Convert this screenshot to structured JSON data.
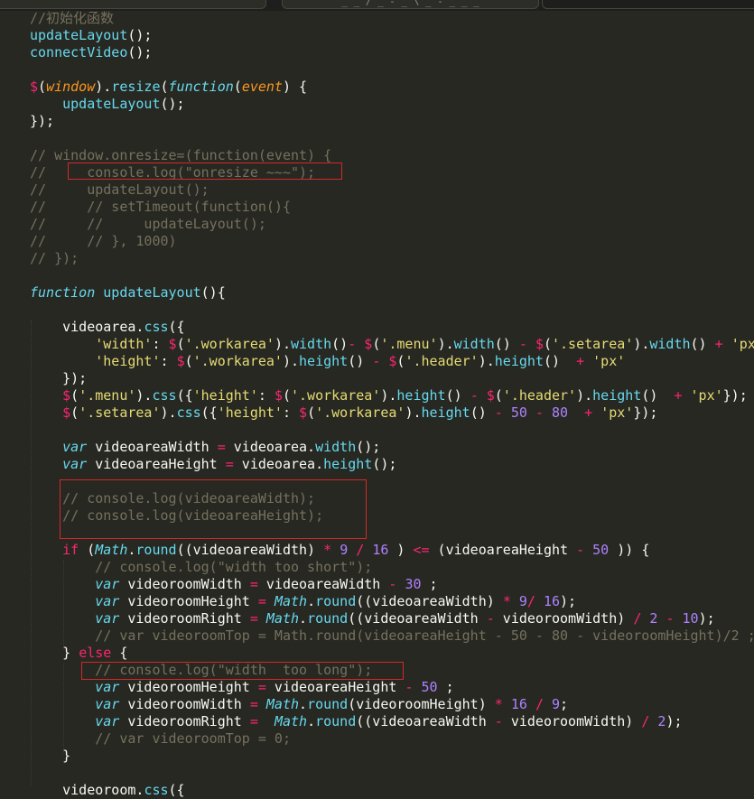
{
  "editor": {
    "tabs": [
      "",
      "_        _ / _ - _ \\ _ - _ _ _",
      ""
    ],
    "lines": [
      [
        [
          "c",
          "//初始化函数"
        ]
      ],
      [
        [
          "f",
          "updateLayout"
        ],
        [
          "m",
          "();"
        ]
      ],
      [
        [
          "f",
          "connectVideo"
        ],
        [
          "m",
          "();"
        ]
      ],
      [],
      [
        [
          "o",
          "$"
        ],
        [
          "m",
          "("
        ],
        [
          "p",
          "window"
        ],
        [
          "m",
          ")."
        ],
        [
          "f",
          "resize"
        ],
        [
          "m",
          "("
        ],
        [
          "k",
          "function"
        ],
        [
          "m",
          "("
        ],
        [
          "p",
          "event"
        ],
        [
          "m",
          ") {"
        ]
      ],
      [
        [
          "m",
          "    "
        ],
        [
          "f",
          "updateLayout"
        ],
        [
          "m",
          "();"
        ]
      ],
      [
        [
          "m",
          "});"
        ]
      ],
      [],
      [
        [
          "c",
          "// window.onresize=(function(event) {"
        ]
      ],
      [
        [
          "c",
          "//     console.log(\"onresize ~~~\");"
        ]
      ],
      [
        [
          "c",
          "//     updateLayout();"
        ]
      ],
      [
        [
          "c",
          "//     // setTimeout(function(){"
        ]
      ],
      [
        [
          "c",
          "//     //     updateLayout();"
        ]
      ],
      [
        [
          "c",
          "//     // }, 1000)"
        ]
      ],
      [
        [
          "c",
          "// });"
        ]
      ],
      [],
      [
        [
          "k",
          "function"
        ],
        [
          "m",
          " "
        ],
        [
          "f",
          "updateLayout"
        ],
        [
          "m",
          "(){"
        ]
      ],
      [],
      [
        [
          "m",
          "    videoarea."
        ],
        [
          "f",
          "css"
        ],
        [
          "m",
          "({"
        ]
      ],
      [
        [
          "m",
          "        "
        ],
        [
          "s",
          "'width'"
        ],
        [
          "m",
          ": "
        ],
        [
          "o",
          "$"
        ],
        [
          "m",
          "("
        ],
        [
          "s",
          "'.workarea'"
        ],
        [
          "m",
          ")."
        ],
        [
          "f",
          "width"
        ],
        [
          "m",
          "()"
        ],
        [
          "o",
          "-"
        ],
        [
          "m",
          " "
        ],
        [
          "o",
          "$"
        ],
        [
          "m",
          "("
        ],
        [
          "s",
          "'.menu'"
        ],
        [
          "m",
          ")."
        ],
        [
          "f",
          "width"
        ],
        [
          "m",
          "() "
        ],
        [
          "o",
          "-"
        ],
        [
          "m",
          " "
        ],
        [
          "o",
          "$"
        ],
        [
          "m",
          "("
        ],
        [
          "s",
          "'.setarea'"
        ],
        [
          "m",
          ")."
        ],
        [
          "f",
          "width"
        ],
        [
          "m",
          "() "
        ],
        [
          "o",
          "+"
        ],
        [
          "m",
          " "
        ],
        [
          "s",
          "'px'"
        ]
      ],
      [
        [
          "m",
          "        "
        ],
        [
          "s",
          "'height'"
        ],
        [
          "m",
          ": "
        ],
        [
          "o",
          "$"
        ],
        [
          "m",
          "("
        ],
        [
          "s",
          "'.workarea'"
        ],
        [
          "m",
          ")."
        ],
        [
          "f",
          "height"
        ],
        [
          "m",
          "() "
        ],
        [
          "o",
          "-"
        ],
        [
          "m",
          " "
        ],
        [
          "o",
          "$"
        ],
        [
          "m",
          "("
        ],
        [
          "s",
          "'.header'"
        ],
        [
          "m",
          ")."
        ],
        [
          "f",
          "height"
        ],
        [
          "m",
          "()  "
        ],
        [
          "o",
          "+"
        ],
        [
          "m",
          " "
        ],
        [
          "s",
          "'px'"
        ]
      ],
      [
        [
          "m",
          "    });"
        ]
      ],
      [
        [
          "m",
          "    "
        ],
        [
          "o",
          "$"
        ],
        [
          "m",
          "("
        ],
        [
          "s",
          "'.menu'"
        ],
        [
          "m",
          ")."
        ],
        [
          "f",
          "css"
        ],
        [
          "m",
          "({"
        ],
        [
          "s",
          "'height'"
        ],
        [
          "m",
          ": "
        ],
        [
          "o",
          "$"
        ],
        [
          "m",
          "("
        ],
        [
          "s",
          "'.workarea'"
        ],
        [
          "m",
          ")."
        ],
        [
          "f",
          "height"
        ],
        [
          "m",
          "() "
        ],
        [
          "o",
          "-"
        ],
        [
          "m",
          " "
        ],
        [
          "o",
          "$"
        ],
        [
          "m",
          "("
        ],
        [
          "s",
          "'.header'"
        ],
        [
          "m",
          ")."
        ],
        [
          "f",
          "height"
        ],
        [
          "m",
          "()  "
        ],
        [
          "o",
          "+"
        ],
        [
          "m",
          " "
        ],
        [
          "s",
          "'px'"
        ],
        [
          "m",
          "});"
        ]
      ],
      [
        [
          "m",
          "    "
        ],
        [
          "o",
          "$"
        ],
        [
          "m",
          "("
        ],
        [
          "s",
          "'.setarea'"
        ],
        [
          "m",
          ")."
        ],
        [
          "f",
          "css"
        ],
        [
          "m",
          "({"
        ],
        [
          "s",
          "'height'"
        ],
        [
          "m",
          ": "
        ],
        [
          "o",
          "$"
        ],
        [
          "m",
          "("
        ],
        [
          "s",
          "'.workarea'"
        ],
        [
          "m",
          ")."
        ],
        [
          "f",
          "height"
        ],
        [
          "m",
          "() "
        ],
        [
          "o",
          "-"
        ],
        [
          "m",
          " "
        ],
        [
          "n",
          "50"
        ],
        [
          "m",
          " "
        ],
        [
          "o",
          "-"
        ],
        [
          "m",
          " "
        ],
        [
          "n",
          "80"
        ],
        [
          "m",
          "  "
        ],
        [
          "o",
          "+"
        ],
        [
          "m",
          " "
        ],
        [
          "s",
          "'px'"
        ],
        [
          "m",
          "});"
        ]
      ],
      [],
      [
        [
          "m",
          "    "
        ],
        [
          "k",
          "var"
        ],
        [
          "m",
          " videoareaWidth "
        ],
        [
          "o",
          "="
        ],
        [
          "m",
          " videoarea."
        ],
        [
          "f",
          "width"
        ],
        [
          "m",
          "();"
        ]
      ],
      [
        [
          "m",
          "    "
        ],
        [
          "k",
          "var"
        ],
        [
          "m",
          " videoareaHeight "
        ],
        [
          "o",
          "="
        ],
        [
          "m",
          " videoarea."
        ],
        [
          "f",
          "height"
        ],
        [
          "m",
          "();"
        ]
      ],
      [],
      [
        [
          "m",
          "    "
        ],
        [
          "c",
          "// console.log(videoareaWidth);"
        ]
      ],
      [
        [
          "m",
          "    "
        ],
        [
          "c",
          "// console.log(videoareaHeight);"
        ]
      ],
      [],
      [
        [
          "m",
          "    "
        ],
        [
          "o",
          "if"
        ],
        [
          "m",
          " ("
        ],
        [
          "sd",
          "Math"
        ],
        [
          "m",
          "."
        ],
        [
          "f",
          "round"
        ],
        [
          "m",
          "((videoareaWidth) "
        ],
        [
          "o",
          "*"
        ],
        [
          "m",
          " "
        ],
        [
          "n",
          "9"
        ],
        [
          "m",
          " "
        ],
        [
          "o",
          "/"
        ],
        [
          "m",
          " "
        ],
        [
          "n",
          "16"
        ],
        [
          "m",
          " ) "
        ],
        [
          "o",
          "<="
        ],
        [
          "m",
          " (videoareaHeight "
        ],
        [
          "o",
          "-"
        ],
        [
          "m",
          " "
        ],
        [
          "n",
          "50"
        ],
        [
          "m",
          " )) {"
        ]
      ],
      [
        [
          "m",
          "        "
        ],
        [
          "c",
          "// console.log(\"width too short\");"
        ]
      ],
      [
        [
          "m",
          "        "
        ],
        [
          "k",
          "var"
        ],
        [
          "m",
          " videoroomWidth "
        ],
        [
          "o",
          "="
        ],
        [
          "m",
          " videoareaWidth "
        ],
        [
          "o",
          "-"
        ],
        [
          "m",
          " "
        ],
        [
          "n",
          "30"
        ],
        [
          "m",
          " ;"
        ]
      ],
      [
        [
          "m",
          "        "
        ],
        [
          "k",
          "var"
        ],
        [
          "m",
          " videoroomHeight "
        ],
        [
          "o",
          "="
        ],
        [
          "m",
          " "
        ],
        [
          "sd",
          "Math"
        ],
        [
          "m",
          "."
        ],
        [
          "f",
          "round"
        ],
        [
          "m",
          "((videoareaWidth) "
        ],
        [
          "o",
          "*"
        ],
        [
          "m",
          " "
        ],
        [
          "n",
          "9"
        ],
        [
          "o",
          "/"
        ],
        [
          "m",
          " "
        ],
        [
          "n",
          "16"
        ],
        [
          "m",
          ");"
        ]
      ],
      [
        [
          "m",
          "        "
        ],
        [
          "k",
          "var"
        ],
        [
          "m",
          " videoroomRight "
        ],
        [
          "o",
          "="
        ],
        [
          "m",
          " "
        ],
        [
          "sd",
          "Math"
        ],
        [
          "m",
          "."
        ],
        [
          "f",
          "round"
        ],
        [
          "m",
          "((videoareaWidth "
        ],
        [
          "o",
          "-"
        ],
        [
          "m",
          " videoroomWidth) "
        ],
        [
          "o",
          "/"
        ],
        [
          "m",
          " "
        ],
        [
          "n",
          "2"
        ],
        [
          "m",
          " "
        ],
        [
          "o",
          "-"
        ],
        [
          "m",
          " "
        ],
        [
          "n",
          "10"
        ],
        [
          "m",
          ");"
        ]
      ],
      [
        [
          "m",
          "        "
        ],
        [
          "c",
          "// var videoroomTop = Math.round(videoareaHeight - 50 - 80 - videoroomHeight)/2 ;"
        ]
      ],
      [
        [
          "m",
          "    } "
        ],
        [
          "o",
          "else"
        ],
        [
          "m",
          " {"
        ]
      ],
      [
        [
          "m",
          "        "
        ],
        [
          "c",
          "// console.log(\"width  too long\");"
        ]
      ],
      [
        [
          "m",
          "        "
        ],
        [
          "k",
          "var"
        ],
        [
          "m",
          " videoroomHeight "
        ],
        [
          "o",
          "="
        ],
        [
          "m",
          " videoareaHeight "
        ],
        [
          "o",
          "-"
        ],
        [
          "m",
          " "
        ],
        [
          "n",
          "50"
        ],
        [
          "m",
          " ;"
        ]
      ],
      [
        [
          "m",
          "        "
        ],
        [
          "k",
          "var"
        ],
        [
          "m",
          " videoroomWidth "
        ],
        [
          "o",
          "="
        ],
        [
          "m",
          " "
        ],
        [
          "sd",
          "Math"
        ],
        [
          "m",
          "."
        ],
        [
          "f",
          "round"
        ],
        [
          "m",
          "(videoroomHeight) "
        ],
        [
          "o",
          "*"
        ],
        [
          "m",
          " "
        ],
        [
          "n",
          "16"
        ],
        [
          "m",
          " "
        ],
        [
          "o",
          "/"
        ],
        [
          "m",
          " "
        ],
        [
          "n",
          "9"
        ],
        [
          "m",
          ";"
        ]
      ],
      [
        [
          "m",
          "        "
        ],
        [
          "k",
          "var"
        ],
        [
          "m",
          " videoroomRight "
        ],
        [
          "o",
          "="
        ],
        [
          "m",
          "  "
        ],
        [
          "sd",
          "Math"
        ],
        [
          "m",
          "."
        ],
        [
          "f",
          "round"
        ],
        [
          "m",
          "((videoareaWidth "
        ],
        [
          "o",
          "-"
        ],
        [
          "m",
          " videoroomWidth) "
        ],
        [
          "o",
          "/"
        ],
        [
          "m",
          " "
        ],
        [
          "n",
          "2"
        ],
        [
          "m",
          ");"
        ]
      ],
      [
        [
          "m",
          "        "
        ],
        [
          "c",
          "// var videoroomTop = 0;"
        ]
      ],
      [
        [
          "m",
          "    }"
        ]
      ],
      [],
      [
        [
          "m",
          "    videoroom."
        ],
        [
          "f",
          "css"
        ],
        [
          "m",
          "({"
        ]
      ]
    ]
  }
}
